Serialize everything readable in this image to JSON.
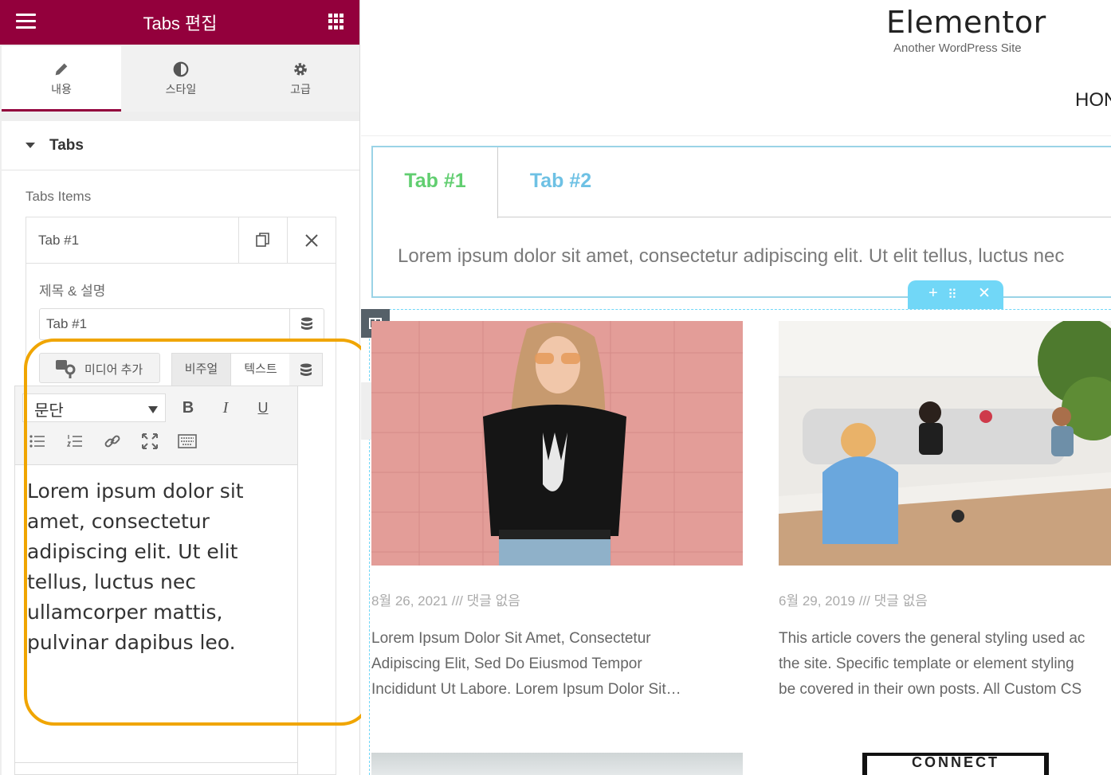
{
  "panel": {
    "title": "Tabs 편집",
    "tabs": [
      {
        "label": "내용",
        "icon": "pencil-icon"
      },
      {
        "label": "스타일",
        "icon": "contrast-icon"
      },
      {
        "label": "고급",
        "icon": "gear-icon"
      }
    ],
    "section_label": "Tabs",
    "items_label": "Tabs Items",
    "repeater_item_title": "Tab #1",
    "field_label": "제목 & 설명",
    "title_value": "Tab #1",
    "media_button": "미디어 추가",
    "mode_visual": "비주얼",
    "mode_text": "텍스트",
    "format_select": "문단",
    "editor_content": "Lorem ipsum dolor sit amet, consectetur adipiscing elit. Ut elit tellus, luctus nec ullamcorper mattis, pulvinar dapibus leo."
  },
  "preview": {
    "site_title": "Elementor",
    "site_tagline": "Another WordPress Site",
    "nav_partial": "HON",
    "tab1": "Tab #1",
    "tab2": "Tab #2",
    "tab_content": "Lorem ipsum dolor sit amet, consectetur adipiscing elit. Ut elit tellus, luctus nec",
    "posts": [
      {
        "meta": "8월 26, 2021 /// 댓글 없음",
        "excerpt_lines": [
          "Lorem Ipsum Dolor Sit Amet, Consectetur",
          "Adipiscing Elit, Sed Do Eiusmod Tempor",
          "Incididunt Ut Labore. Lorem Ipsum Dolor Sit…"
        ]
      },
      {
        "meta": "6월 29, 2019 /// 댓글 없음",
        "excerpt_lines": [
          "This article covers the general styling used ac",
          "the site. Specific template or element styling",
          "be covered in their own posts. All Custom CS"
        ]
      }
    ],
    "connect_label": "CONNECT"
  },
  "colors": {
    "brand": "#93003c",
    "accent_green": "#61ce70",
    "accent_blue": "#6ec1e4",
    "highlight": "#f0a500",
    "handle": "#71d7f7"
  }
}
